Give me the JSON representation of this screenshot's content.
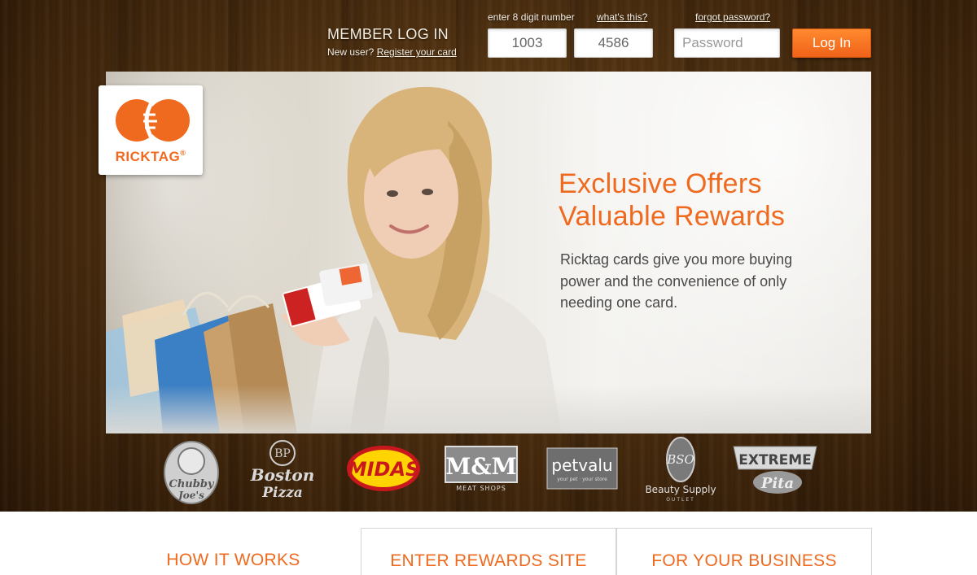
{
  "login": {
    "title": "MEMBER LOG IN",
    "new_user_text": "New user?",
    "register_link": "Register your card",
    "digit_label": "enter 8 digit number",
    "whats_this": "what's this?",
    "forgot_password": "forgot password?",
    "card_part1": "1003",
    "card_part2": "4586",
    "password_placeholder": "Password",
    "login_button": "Log In"
  },
  "logo": {
    "text": "RICKTAG",
    "trademark": "®"
  },
  "hero": {
    "headline_line1": "Exclusive Offers",
    "headline_line2": "Valuable Rewards",
    "description": "Ricktag cards give you more buying power and the convenience of only needing one card."
  },
  "brands": [
    {
      "name": "Chubby Joe's",
      "line1": "Chubby",
      "line2": "Joe's"
    },
    {
      "name": "Boston Pizza",
      "line1": "Boston",
      "line2": "Pizza"
    },
    {
      "name": "Midas",
      "line1": "MIDAS"
    },
    {
      "name": "M&M Meat Shops",
      "line1": "M&M",
      "line2": "MEAT SHOPS"
    },
    {
      "name": "Pet Valu",
      "line1": "petvalu",
      "line2": "your pet · your store"
    },
    {
      "name": "Beauty Supply Outlet",
      "line1": "BSO",
      "line2": "Beauty Supply",
      "line3": "OUTLET"
    },
    {
      "name": "Extreme Pita",
      "line1": "EXTREME",
      "line2": "Pita"
    }
  ],
  "nav": {
    "how_it_works": "HOW IT WORKS",
    "enter_rewards": "ENTER REWARDS SITE",
    "for_business": "FOR YOUR BUSINESS"
  },
  "colors": {
    "accent": "#ef6a1f",
    "wood_dark": "#2c1806",
    "wood_mid": "#6b4418"
  }
}
